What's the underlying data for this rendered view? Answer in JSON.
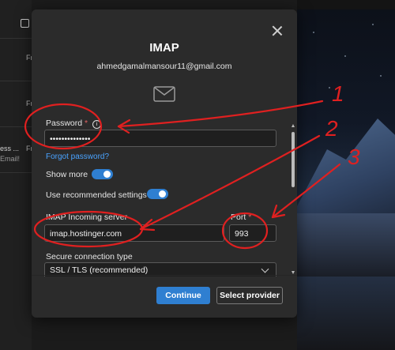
{
  "background": {
    "sender_prefix": "Fr",
    "side_text_1": "ess ...",
    "side_text_2": "Email!"
  },
  "dialog": {
    "title": "IMAP",
    "email": "ahmedgamalmansour11@gmail.com",
    "password": {
      "label": "Password",
      "required_mark": "*",
      "value": "••••••••••••••"
    },
    "forgot_password": "Forgot password?",
    "show_more": {
      "label": "Show more",
      "on": true
    },
    "use_recommended": {
      "label": "Use recommended settings",
      "on": true
    },
    "imap_server": {
      "label": "IMAP Incoming server",
      "value": "imap.hostinger.com"
    },
    "port": {
      "label": "Port",
      "required_mark": "*",
      "value": "993"
    },
    "secure_connection": {
      "label": "Secure connection type",
      "selected": "SSL / TLS (recommended)"
    },
    "continue_button": "Continue",
    "select_provider_button": "Select provider"
  },
  "annotations": {
    "color": "#e02020",
    "labels": [
      "1",
      "2",
      "3"
    ]
  },
  "colors": {
    "accent": "#2f7fd1",
    "link": "#4aa3ff",
    "dialog_bg": "#2b2b2b"
  }
}
